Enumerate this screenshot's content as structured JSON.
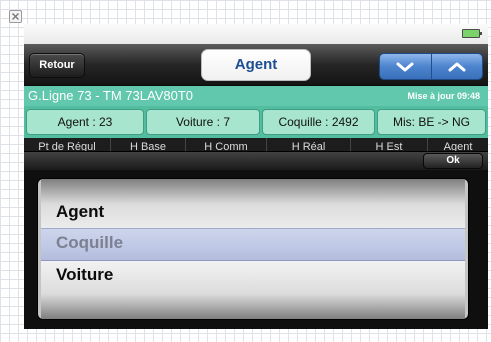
{
  "navbar": {
    "back_label": "Retour",
    "title": "Agent"
  },
  "info": {
    "line": "G.Ligne 73 - TM 73LAV80T0",
    "update": "Mise à jour 09:48"
  },
  "counts": [
    "Agent : 23",
    "Voiture : 7",
    "Coquille : 2492",
    "Mis: BE -> NG"
  ],
  "columns": [
    "Pt de Régul",
    "H Base",
    "H Comm",
    "H Réal",
    "H Est",
    "Agent"
  ],
  "toolbar": {
    "ok_label": "Ok"
  },
  "picker": {
    "options": [
      "Agent",
      "Coquille",
      "Voiture"
    ],
    "selected": "Coquille"
  },
  "colors": {
    "info_bar": "#61c8ad",
    "count_cells": "#a7e5cf",
    "nav_arrows": "#4c84cd",
    "title_text": "#1d4e93"
  },
  "icons": {
    "close": "close-icon",
    "battery": "battery-icon",
    "down": "chevron-down-icon",
    "up": "chevron-up-icon"
  }
}
